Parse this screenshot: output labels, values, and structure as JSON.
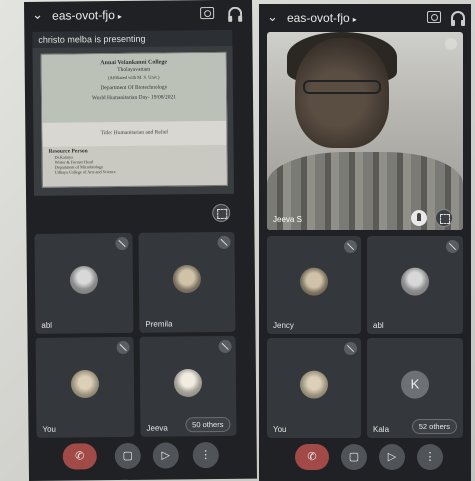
{
  "left_phone": {
    "meeting_code": "eas-ovot-fjo",
    "presenting_banner": "christo melba is presenting",
    "slide": {
      "college_line1": "Annai Velankanni College",
      "college_line2": "Tholayavattam",
      "college_line3": "(Affiliated with M. S. Univ.)",
      "department": "Department Of Biotechnology",
      "event": "World Humanitarian Day- 19/08/2021",
      "title": "Title: Humanitarian and Relief",
      "resource_heading": "Resource Person",
      "resource_lines": [
        "Dr.Kalaiya",
        "Writer & Former Head",
        "Department of Microbiology",
        "Udhaya College of Arts and Science"
      ]
    },
    "tiles": [
      {
        "name": "abl"
      },
      {
        "name": "Premila"
      },
      {
        "name": "You"
      },
      {
        "name": "Jeeva"
      }
    ],
    "others_badge": "50 others"
  },
  "right_phone": {
    "meeting_code": "eas-ovot-fjo",
    "video_name": "Jeeva S",
    "tiles": [
      {
        "name": "Jency"
      },
      {
        "name": "abl"
      },
      {
        "name": "You"
      },
      {
        "name": "Kala",
        "initial": "K"
      }
    ],
    "others_badge": "52 others"
  },
  "icons": {
    "back": "chevron-down-icon",
    "camera_switch": "camera-switch-icon",
    "audio": "headphones-icon",
    "end_call": "end-call-icon",
    "camera_off": "camera-off-icon",
    "mic_off": "mic-off-icon",
    "more": "more-vert-icon"
  },
  "colors": {
    "background": "#1f2124",
    "tile": "#34373b",
    "end_call": "#a24a47",
    "control": "#505357"
  }
}
